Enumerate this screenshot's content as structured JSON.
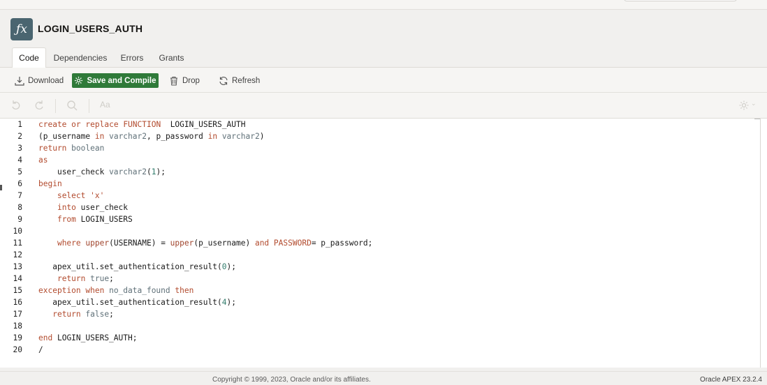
{
  "header": {
    "icon": "function-icon",
    "icon_glyph": "ƒx",
    "title": "LOGIN_USERS_AUTH"
  },
  "tabs": [
    {
      "label": "Code",
      "active": true
    },
    {
      "label": "Dependencies",
      "active": false
    },
    {
      "label": "Errors",
      "active": false
    },
    {
      "label": "Grants",
      "active": false
    }
  ],
  "toolbar": {
    "download_label": "Download",
    "save_compile_label": "Save and Compile",
    "drop_label": "Drop",
    "refresh_label": "Refresh"
  },
  "editor_toolbar": {
    "undo": "undo-icon",
    "redo": "redo-icon",
    "search": "search-icon",
    "text_case": "Aa",
    "settings": "gear-icon"
  },
  "code_lines": [
    {
      "n": "1",
      "text": "create or replace FUNCTION  LOGIN_USERS_AUTH"
    },
    {
      "n": "2",
      "text": "(p_username in varchar2, p_password in varchar2)"
    },
    {
      "n": "3",
      "text": "return boolean"
    },
    {
      "n": "4",
      "text": "as"
    },
    {
      "n": "5",
      "text": "    user_check varchar2(1);"
    },
    {
      "n": "6",
      "text": "begin"
    },
    {
      "n": "7",
      "text": "    select 'x'"
    },
    {
      "n": "8",
      "text": "    into user_check"
    },
    {
      "n": "9",
      "text": "    from LOGIN_USERS"
    },
    {
      "n": "10",
      "text": ""
    },
    {
      "n": "11",
      "text": "    where upper(USERNAME) = upper(p_username) and PASSWORD= p_password;"
    },
    {
      "n": "12",
      "text": ""
    },
    {
      "n": "13",
      "text": "   apex_util.set_authentication_result(0);"
    },
    {
      "n": "14",
      "text": "    return true;"
    },
    {
      "n": "15",
      "text": "exception when no_data_found then"
    },
    {
      "n": "16",
      "text": "   apex_util.set_authentication_result(4);"
    },
    {
      "n": "17",
      "text": "   return false;"
    },
    {
      "n": "18",
      "text": ""
    },
    {
      "n": "19",
      "text": "end LOGIN_USERS_AUTH;"
    },
    {
      "n": "20",
      "text": "/"
    }
  ],
  "footer": {
    "copyright": "Copyright © 1999, 2023, Oracle and/or its affiliates.",
    "version": "Oracle APEX 23.2.4"
  },
  "colors": {
    "accent_green": "#2f7a39",
    "badge": "#4a6570",
    "keyword": "#b24b2e"
  }
}
